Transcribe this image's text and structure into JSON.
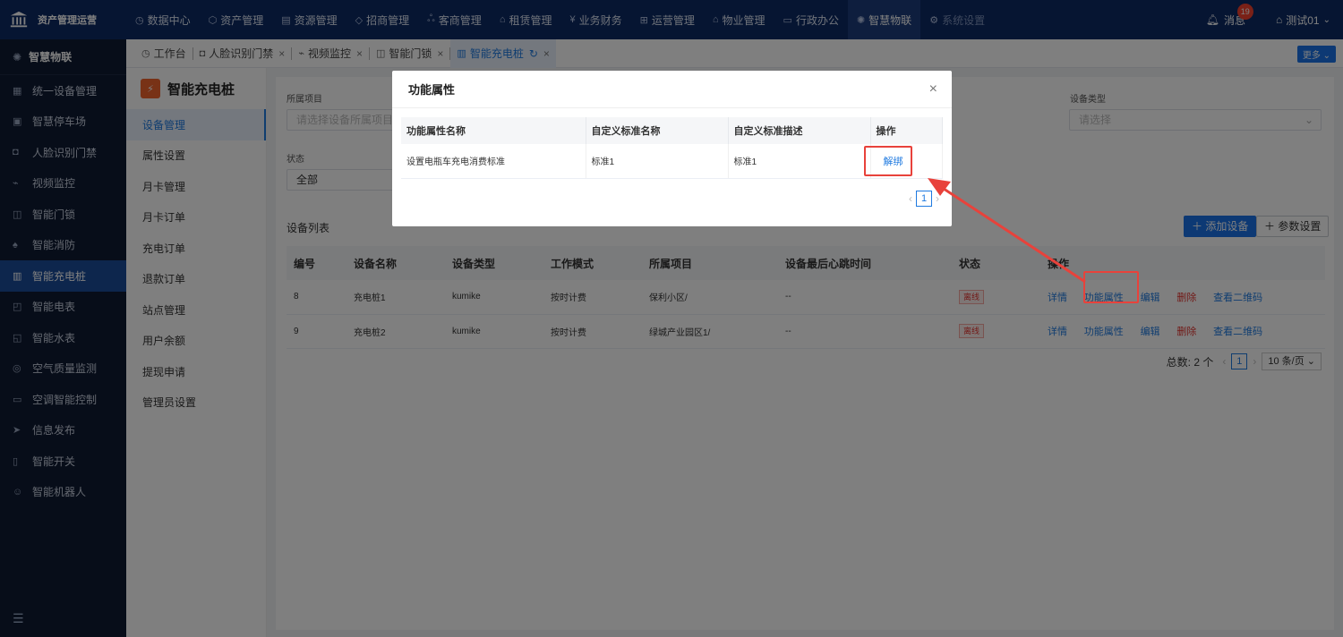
{
  "app": {
    "title": "资产管理运营"
  },
  "topnav": [
    {
      "label": "数据中心",
      "icon": "clock-icon"
    },
    {
      "label": "资产管理",
      "icon": "cube-icon"
    },
    {
      "label": "资源管理",
      "icon": "chart-icon"
    },
    {
      "label": "招商管理",
      "icon": "tag-icon"
    },
    {
      "label": "客商管理",
      "icon": "people-icon"
    },
    {
      "label": "租赁管理",
      "icon": "home-icon"
    },
    {
      "label": "业务财务",
      "icon": "yen-icon"
    },
    {
      "label": "运营管理",
      "icon": "grid-icon"
    },
    {
      "label": "物业管理",
      "icon": "building-icon"
    },
    {
      "label": "行政办公",
      "icon": "monitor-icon"
    },
    {
      "label": "智慧物联",
      "icon": "sun-icon"
    },
    {
      "label": "系统设置",
      "icon": "settings-icon"
    }
  ],
  "topright": {
    "messages": "消息",
    "badge": "19",
    "user": "测试01"
  },
  "sidebar": {
    "header": "智慧物联",
    "items": [
      {
        "label": "统一设备管理"
      },
      {
        "label": "智慧停车场"
      },
      {
        "label": "人脸识别门禁"
      },
      {
        "label": "视频监控"
      },
      {
        "label": "智能门锁"
      },
      {
        "label": "智能消防"
      },
      {
        "label": "智能充电桩"
      },
      {
        "label": "智能电表"
      },
      {
        "label": "智能水表"
      },
      {
        "label": "空气质量监测"
      },
      {
        "label": "空调智能控制"
      },
      {
        "label": "信息发布"
      },
      {
        "label": "智能开关"
      },
      {
        "label": "智能机器人"
      }
    ]
  },
  "tabs": [
    {
      "label": "工作台"
    },
    {
      "label": "人脸识别门禁"
    },
    {
      "label": "视频监控"
    },
    {
      "label": "智能门锁"
    },
    {
      "label": "智能充电桩"
    }
  ],
  "more_label": "更多",
  "subside": {
    "title": "智能充电桩",
    "items": [
      "设备管理",
      "属性设置",
      "月卡管理",
      "月卡订单",
      "充电订单",
      "退款订单",
      "站点管理",
      "用户余额",
      "提现申请",
      "管理员设置"
    ]
  },
  "filters": {
    "project_label": "所属项目",
    "project_placeholder": "请选择设备所属项目",
    "type_label": "设备类型",
    "type_placeholder": "请选择",
    "status_label": "状态",
    "status_value": "全部"
  },
  "device_list": {
    "title": "设备列表",
    "add_button": "添加设备",
    "param_button": "参数设置",
    "columns": [
      "编号",
      "设备名称",
      "设备类型",
      "工作模式",
      "所属项目",
      "设备最后心跳时间",
      "状态",
      "操作"
    ],
    "rows": [
      {
        "id": "8",
        "name": "充电桩1",
        "type": "kumike",
        "mode": "按时计费",
        "project": "保利小区/",
        "heartbeat": "--",
        "status": "离线"
      },
      {
        "id": "9",
        "name": "充电桩2",
        "type": "kumike",
        "mode": "按时计费",
        "project": "绿城产业园区1/",
        "heartbeat": "--",
        "status": "离线"
      }
    ],
    "actions": {
      "detail": "详情",
      "func": "功能属性",
      "edit": "编辑",
      "delete": "删除",
      "qrcode": "查看二维码"
    },
    "pager": {
      "total": "总数: 2 个",
      "page": "1",
      "page_size": "10 条/页"
    }
  },
  "modal": {
    "title": "功能属性",
    "columns": [
      "功能属性名称",
      "自定义标准名称",
      "自定义标准描述",
      "操作"
    ],
    "rows": [
      {
        "name": "设置电瓶车充电消费标准",
        "std_name": "标准1",
        "std_desc": "标准1",
        "action": "解绑"
      }
    ],
    "page": "1"
  }
}
